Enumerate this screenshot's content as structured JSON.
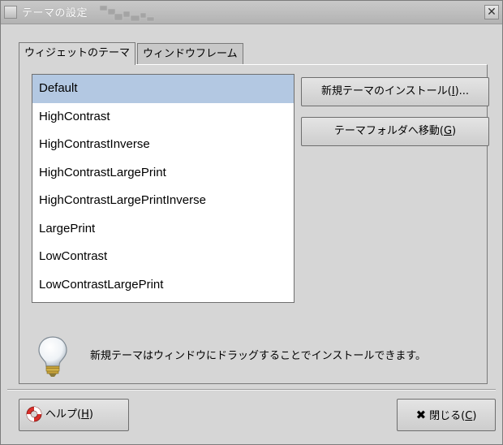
{
  "window": {
    "title": "テーマの設定",
    "close_glyph": "✕"
  },
  "tabs": [
    {
      "label": "ウィジェットのテーマ",
      "active": true
    },
    {
      "label": "ウィンドウフレーム",
      "active": false
    }
  ],
  "themes": {
    "selected_index": 0,
    "items": [
      "Default",
      "HighContrast",
      "HighContrastInverse",
      "HighContrastLargePrint",
      "HighContrastLargePrintInverse",
      "LargePrint",
      "LowContrast",
      "LowContrastLargePrint"
    ]
  },
  "buttons": {
    "install": {
      "label": "新規テーマのインストール(",
      "mnemonic": "I",
      "suffix": ")..."
    },
    "goto_folder": {
      "label": "テーマフォルダへ移動(",
      "mnemonic": "G",
      "suffix": ")"
    },
    "help": {
      "label": "ヘルプ(",
      "mnemonic": "H",
      "suffix": ")"
    },
    "close": {
      "label": "閉じる(",
      "mnemonic": "C",
      "suffix": ")",
      "glyph": "✖"
    }
  },
  "hint": {
    "text": "新規テーマはウィンドウにドラッグすることでインストールできます。",
    "icon": "lightbulb-icon"
  },
  "colors": {
    "selection": "#b3c8e2",
    "window_bg": "#d6d6d6"
  }
}
